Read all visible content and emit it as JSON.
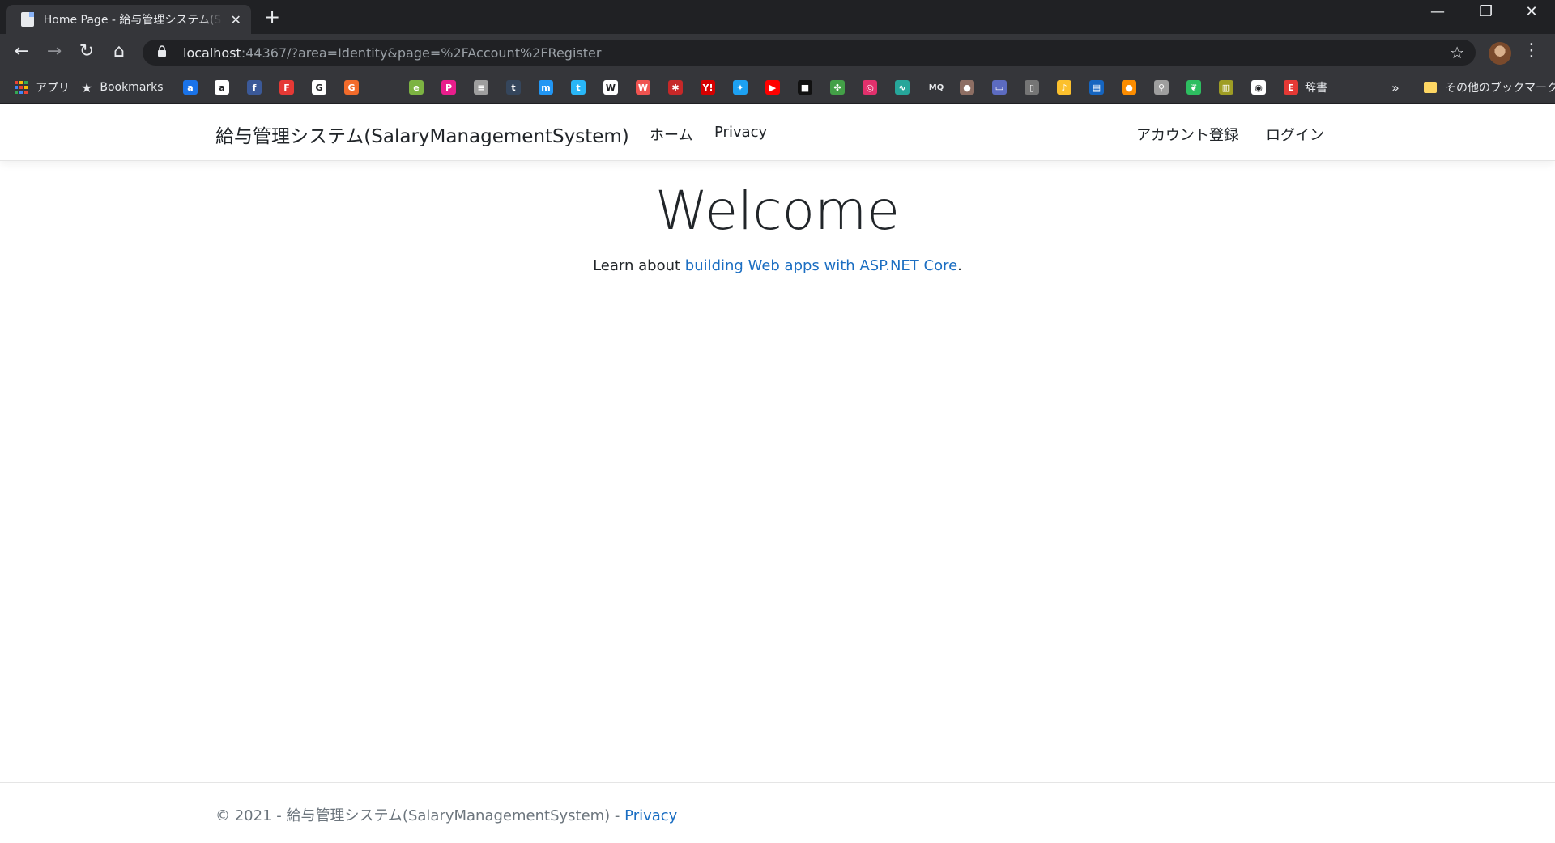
{
  "browser": {
    "tab": {
      "title": "Home Page - 給与管理システム(Sa",
      "close": "✕"
    },
    "new_tab": "+",
    "window_controls": {
      "minimize": "—",
      "restore": "❐",
      "close": "✕"
    },
    "nav": {
      "back": "←",
      "forward": "→",
      "reload": "↻",
      "home": "⌂"
    },
    "address": {
      "host": "localhost",
      "rest": ":44367/?area=Identity&page=%2FAccount%2FRegister"
    },
    "star": "☆",
    "menu": "⋮",
    "bookmarks": {
      "apps_label": "アプリ",
      "bookmarks_label": "Bookmarks",
      "jisho_label": "辞書",
      "overflow": "»",
      "other_label": "その他のブックマーク",
      "favicons": [
        {
          "name": "a-app-icon",
          "glyph": "a",
          "color": "#1a73e8"
        },
        {
          "name": "amazon-icon",
          "glyph": "a",
          "color": "#ffffff"
        },
        {
          "name": "facebook-icon",
          "glyph": "f",
          "color": "#3b5998"
        },
        {
          "name": "f-app-icon",
          "glyph": "F",
          "color": "#e53935"
        },
        {
          "name": "google-icon",
          "glyph": "G",
          "color": "#ffffff"
        },
        {
          "name": "grammarly-icon",
          "glyph": "G",
          "color": "#f26b2b"
        },
        {
          "name": "green-circle-icon",
          "glyph": "e",
          "color": "#7cb342"
        },
        {
          "name": "pocket-p-icon",
          "glyph": "P",
          "color": "#e91e8c"
        },
        {
          "name": "doc-icon",
          "glyph": "≡",
          "color": "#9e9e9e"
        },
        {
          "name": "tumblr-icon",
          "glyph": "t",
          "color": "#35465c"
        },
        {
          "name": "messenger-icon",
          "glyph": "m",
          "color": "#2196f3"
        },
        {
          "name": "twitter-box-icon",
          "glyph": "t",
          "color": "#29b6f6"
        },
        {
          "name": "wikipedia-icon",
          "glyph": "W",
          "color": "#ffffff"
        },
        {
          "name": "w-red-icon",
          "glyph": "W",
          "color": "#ef5350"
        },
        {
          "name": "paw-icon",
          "glyph": "✱",
          "color": "#c62828"
        },
        {
          "name": "yahoo-icon",
          "glyph": "Y!",
          "color": "#d50000"
        },
        {
          "name": "twitter-icon",
          "glyph": "✦",
          "color": "#1da1f2"
        },
        {
          "name": "youtube-icon",
          "glyph": "▶",
          "color": "#ff0000"
        },
        {
          "name": "black-cat-icon",
          "glyph": "■",
          "color": "#111111"
        },
        {
          "name": "clover-icon",
          "glyph": "✤",
          "color": "#43a047"
        },
        {
          "name": "instagram-icon",
          "glyph": "◎",
          "color": "#e1306c"
        },
        {
          "name": "pulse-icon",
          "glyph": "∿",
          "color": "#26a69a"
        },
        {
          "name": "mq-icon",
          "glyph": "MQ",
          "color": "#35363a"
        },
        {
          "name": "badge-icon",
          "glyph": "●",
          "color": "#8d6e63"
        },
        {
          "name": "keyboard-icon",
          "glyph": "▭",
          "color": "#5c6bc0"
        },
        {
          "name": "phone-icon",
          "glyph": "▯",
          "color": "#757575"
        },
        {
          "name": "music-icon",
          "glyph": "♪",
          "color": "#fbc02d"
        },
        {
          "name": "news-icon",
          "glyph": "▤",
          "color": "#1565c0"
        },
        {
          "name": "orange-icon",
          "glyph": "●",
          "color": "#fb8c00"
        },
        {
          "name": "search-tool-icon",
          "glyph": "⚲",
          "color": "#9e9e9e"
        },
        {
          "name": "evernote-icon",
          "glyph": "❦",
          "color": "#2dbe60"
        },
        {
          "name": "barcode-icon",
          "glyph": "▥",
          "color": "#9e9d24"
        },
        {
          "name": "github-icon",
          "glyph": "◉",
          "color": "#ffffff"
        }
      ]
    }
  },
  "site": {
    "brand": "給与管理システム(SalaryManagementSystem)",
    "nav": {
      "home": "ホーム",
      "privacy": "Privacy",
      "register": "アカウント登録",
      "login": "ログイン"
    },
    "main": {
      "title": "Welcome",
      "lead_prefix": "Learn about ",
      "lead_link": "building Web apps with ASP.NET Core",
      "lead_suffix": "."
    },
    "footer": {
      "text": "© 2021 - 給与管理システム(SalaryManagementSystem) - ",
      "privacy": "Privacy"
    }
  }
}
